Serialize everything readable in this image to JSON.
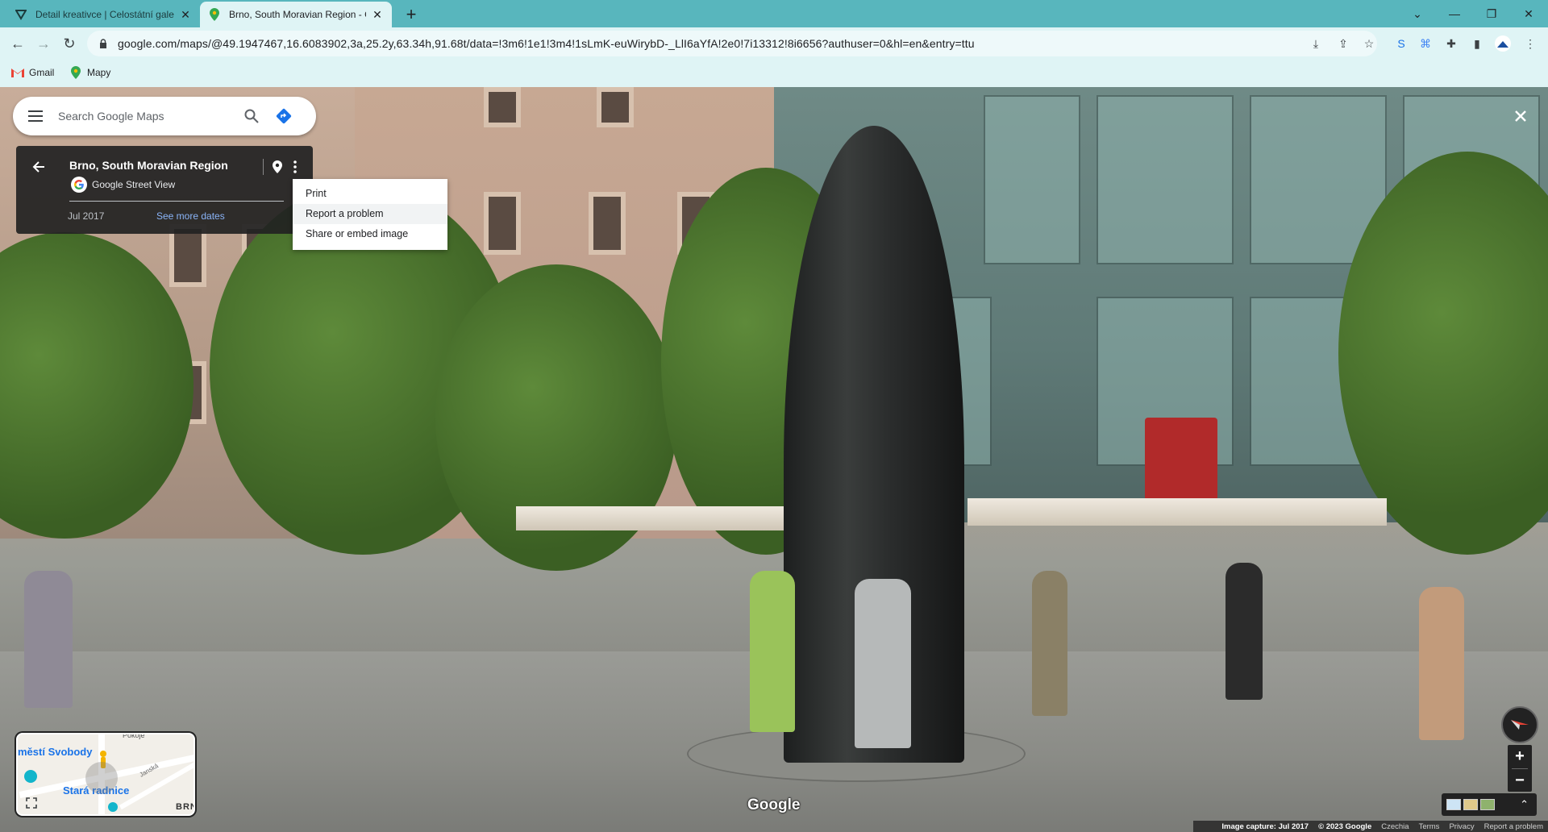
{
  "browser": {
    "tabs": [
      {
        "title": "Detail kreativce | Celostátní gale",
        "active": false
      },
      {
        "title": "Brno, South Moravian Region - G",
        "active": true
      }
    ],
    "url": "google.com/maps/@49.1947467,16.6083902,3a,25.2y,63.34h,91.68t/data=!3m6!1e1!3m4!1sLmK-euWirybD-_LlI6aYfA!2e0!7i13312!8i6656?authuser=0&hl=en&entry=ttu",
    "bookmarks": [
      {
        "label": "Gmail",
        "icon": "gmail-icon"
      },
      {
        "label": "Mapy",
        "icon": "maps-icon"
      }
    ],
    "colors": {
      "tabstrip": "#58b6bd",
      "toolbar": "#dff4f5"
    }
  },
  "search": {
    "placeholder": "Search Google Maps"
  },
  "infocard": {
    "place": "Brno, South Moravian Region",
    "provider": "Google Street View",
    "date": "Jul 2017",
    "more_dates": "See more dates"
  },
  "context_menu": {
    "items": [
      "Print",
      "Report a problem",
      "Share or embed image"
    ],
    "highlighted_index": 1
  },
  "minimap": {
    "labels": [
      "městí Svobody",
      "Stará radnice",
      "BRN",
      "Janská",
      "Pokoje"
    ]
  },
  "branding": {
    "logo": "Google"
  },
  "footer": {
    "image_capture": "Image capture: Jul 2017",
    "copyright": "© 2023 Google",
    "country": "Czechia",
    "terms": "Terms",
    "privacy": "Privacy",
    "report": "Report a problem"
  }
}
